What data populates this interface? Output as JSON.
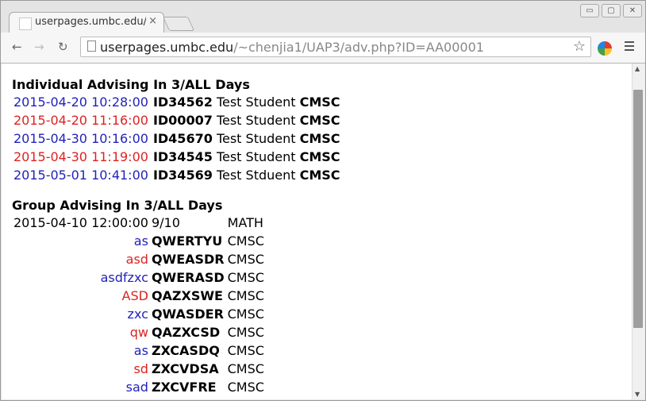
{
  "browser": {
    "tab": {
      "title": "userpages.umbc.edu/",
      "close": "×"
    },
    "window_buttons": {
      "minimize": "▭",
      "maximize": "▢",
      "close": "✕"
    },
    "nav": {
      "back": "←",
      "forward": "→",
      "reload": "↻"
    },
    "address": {
      "host": "userpages.umbc.edu",
      "path": "/~chenjia1/UAP3/adv.php?ID=AA00001"
    },
    "star": "☆"
  },
  "individual": {
    "heading": "Individual Advising In 3/ALL Days",
    "rows": [
      {
        "datetime": "2015-04-20 10:28:00",
        "id": "ID34562",
        "name": "Test Student",
        "dept": "CMSC",
        "color": "#2222bb"
      },
      {
        "datetime": "2015-04-20 11:16:00",
        "id": "ID00007",
        "name": "Test Student",
        "dept": "CMSC",
        "color": "#dd2222"
      },
      {
        "datetime": "2015-04-30 10:16:00",
        "id": "ID45670",
        "name": "Test Student",
        "dept": "CMSC",
        "color": "#2222bb"
      },
      {
        "datetime": "2015-04-30 11:19:00",
        "id": "ID34545",
        "name": "Test Student",
        "dept": "CMSC",
        "color": "#dd2222"
      },
      {
        "datetime": "2015-05-01 10:41:00",
        "id": "ID34569",
        "name": "Test Stduent",
        "dept": "CMSC",
        "color": "#2222bb"
      }
    ]
  },
  "group": {
    "heading": "Group Advising In 3/ALL Days",
    "session": {
      "datetime": "2015-04-10 12:00:00",
      "count": "9/10",
      "dept": "MATH"
    },
    "members": [
      {
        "name": "as",
        "id": "QWERTYU",
        "dept": "CMSC",
        "color": "#2222bb"
      },
      {
        "name": "asd",
        "id": "QWEASDR",
        "dept": "CMSC",
        "color": "#dd2222"
      },
      {
        "name": "asdfzxc",
        "id": "QWERASD",
        "dept": "CMSC",
        "color": "#2222bb"
      },
      {
        "name": "ASD",
        "id": "QAZXSWE",
        "dept": "CMSC",
        "color": "#dd2222"
      },
      {
        "name": "zxc",
        "id": "QWASDER",
        "dept": "CMSC",
        "color": "#2222bb"
      },
      {
        "name": "qw",
        "id": "QAZXCSD",
        "dept": "CMSC",
        "color": "#dd2222"
      },
      {
        "name": "as",
        "id": "ZXCASDQ",
        "dept": "CMSC",
        "color": "#2222bb"
      },
      {
        "name": "sd",
        "id": "ZXCVDSA",
        "dept": "CMSC",
        "color": "#dd2222"
      },
      {
        "name": "sad",
        "id": "ZXCVFRE",
        "dept": "CMSC",
        "color": "#2222bb"
      }
    ]
  }
}
